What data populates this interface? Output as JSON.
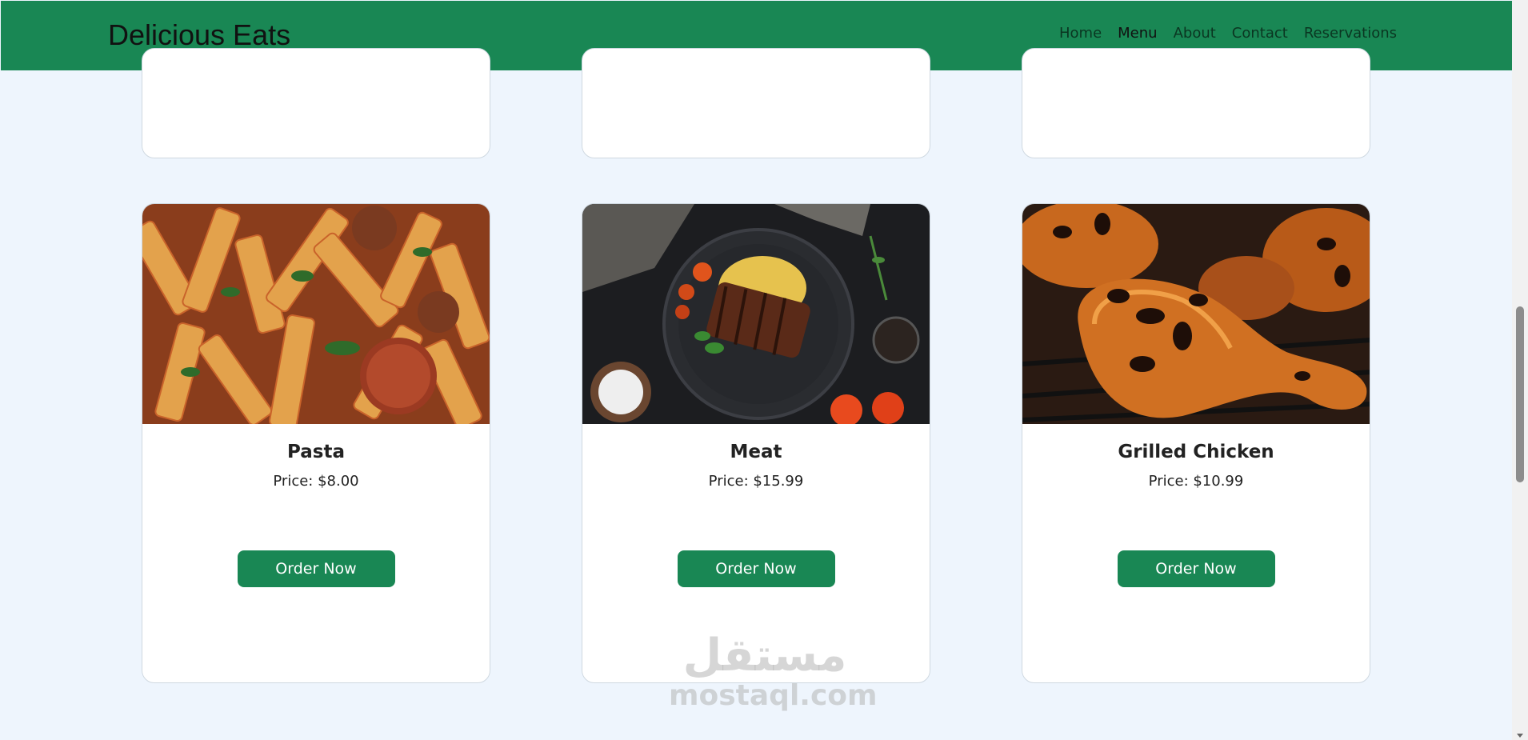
{
  "navbar": {
    "brand": "Delicious Eats",
    "links": [
      "Home",
      "Menu",
      "About",
      "Contact",
      "Reservations"
    ],
    "active": "Menu"
  },
  "menu_items": [
    {
      "name": "Pasta",
      "price": "Price: $8.00",
      "button": "Order Now"
    },
    {
      "name": "Meat",
      "price": "Price: $15.99",
      "button": "Order Now"
    },
    {
      "name": "Grilled Chicken",
      "price": "Price: $10.99",
      "button": "Order Now"
    }
  ],
  "watermark": {
    "arabic": "مستقل",
    "latin": "mostaql.com"
  },
  "colors": {
    "primary": "#198754",
    "background": "#eef5fd",
    "card": "#ffffff"
  }
}
